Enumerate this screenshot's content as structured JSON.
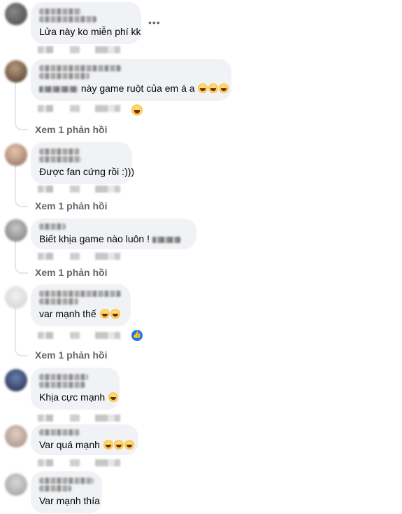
{
  "comments": [
    {
      "text": "Lửa này ko miễn phí kk",
      "emoji_count": 0
    },
    {
      "text": "này game ruột của em á a",
      "emoji_count": 3
    },
    {
      "text": "Được fan cứng rồi :)))",
      "emoji_count": 0
    },
    {
      "text": "Biết khịa game nào luôn !",
      "emoji_count": 0
    },
    {
      "text": "var mạnh thế",
      "emoji_count": 2
    },
    {
      "text": "Khịa cực mạnh",
      "emoji_count": 1
    },
    {
      "text": "Var quá mạnh",
      "emoji_count": 3
    },
    {
      "text": "Var mạnh thía",
      "emoji_count": 0
    }
  ],
  "reply_link": "Xem 1 phản hồi",
  "more_icon": "more-horizontal-icon",
  "reaction_icons": [
    "haha-reaction-icon",
    "like-reaction-icon"
  ],
  "colors": {
    "bubble": "#f0f2f5",
    "secondary_text": "#65676b",
    "like_blue": "#1877f2"
  }
}
